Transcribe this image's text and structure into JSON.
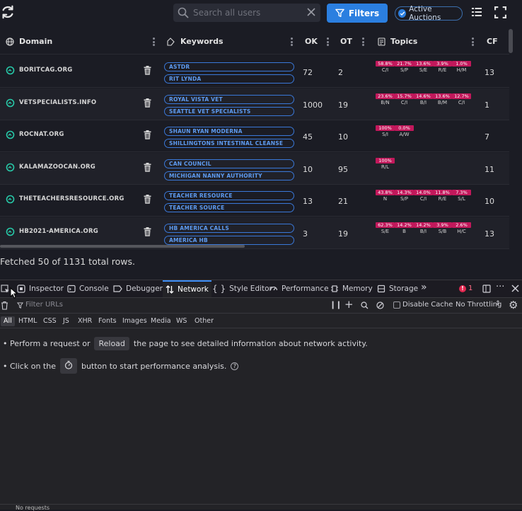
{
  "app": {
    "search": {
      "placeholder": "Search all users"
    },
    "filters_label": "Filters",
    "active_auctions_label": "Active Auctions",
    "columns": {
      "domain": "Domain",
      "keywords": "Keywords",
      "ok": "OK",
      "ot": "OT",
      "topics": "Topics",
      "cf": "CF"
    },
    "rows": [
      {
        "domain": "BORITCAG.ORG",
        "keywords": [
          "ASTDR",
          "RIT LYNDA"
        ],
        "ok": "72",
        "ot": "2",
        "cf": "13",
        "topics": [
          {
            "pct": "58.8%",
            "label": "C/I"
          },
          {
            "pct": "21.7%",
            "label": "S/P"
          },
          {
            "pct": "13.6%",
            "label": "S/E"
          },
          {
            "pct": "3.9%",
            "label": "R/E"
          },
          {
            "pct": "1.0%",
            "label": "H/M"
          }
        ]
      },
      {
        "domain": "VETSPECIALISTS.INFO",
        "keywords": [
          "ROYAL VISTA VET",
          "SEATTLE VET SPECIALISTS"
        ],
        "ok": "1000",
        "ot": "19",
        "cf": "1",
        "topics": [
          {
            "pct": "23.6%",
            "label": "B/N"
          },
          {
            "pct": "15.7%",
            "label": "C/I"
          },
          {
            "pct": "14.6%",
            "label": "B/I"
          },
          {
            "pct": "13.6%",
            "label": "B/M"
          },
          {
            "pct": "12.7%",
            "label": "C/I"
          }
        ]
      },
      {
        "domain": "ROCNAT.ORG",
        "keywords": [
          "SHAUN RYAN MODERNA",
          "SHILLINGTONS INTESTINAL CLEANSE"
        ],
        "ok": "45",
        "ot": "10",
        "cf": "7",
        "topics": [
          {
            "pct": "100%",
            "label": "S/I"
          },
          {
            "pct": "0.0%",
            "label": "A/W"
          }
        ]
      },
      {
        "domain": "KALAMAZOOCAN.ORG",
        "keywords": [
          "CAN COUNCIL",
          "MICHIGAN NANNY AUTHORITY"
        ],
        "ok": "10",
        "ot": "95",
        "cf": "11",
        "topics": [
          {
            "pct": "100%",
            "label": "R/L"
          }
        ]
      },
      {
        "domain": "THETEACHERSRESOURCE.ORG",
        "keywords": [
          "TEACHER RESOURCE",
          "TEACHER SOURCE"
        ],
        "ok": "13",
        "ot": "21",
        "cf": "10",
        "topics": [
          {
            "pct": "43.8%",
            "label": "N"
          },
          {
            "pct": "14.3%",
            "label": "S/P"
          },
          {
            "pct": "14.0%",
            "label": "C/I"
          },
          {
            "pct": "11.8%",
            "label": "R/E"
          },
          {
            "pct": "7.3%",
            "label": "S/L"
          }
        ]
      },
      {
        "domain": "HB2021-AMERICA.ORG",
        "keywords": [
          "HB AMERICA CALLS",
          "AMERICA HB"
        ],
        "ok": "3",
        "ot": "19",
        "cf": "13",
        "topics": [
          {
            "pct": "62.3%",
            "label": "S/E"
          },
          {
            "pct": "14.2%",
            "label": "B"
          },
          {
            "pct": "14.2%",
            "label": "B/I"
          },
          {
            "pct": "3.9%",
            "label": "S/B"
          },
          {
            "pct": "2.6%",
            "label": "H/C"
          }
        ]
      }
    ],
    "fetched_text": "Fetched 50 of 1131 total rows."
  },
  "devtools": {
    "tabs": [
      "Inspector",
      "Console",
      "Debugger",
      "Network",
      "Style Editor",
      "Performance",
      "Memory",
      "Storage"
    ],
    "active_tab": "Network",
    "error_count": "1",
    "filter_placeholder": "Filter URLs",
    "disable_cache_label": "Disable Cache",
    "throttling_label": "No Throttling",
    "type_filters": [
      "All",
      "HTML",
      "CSS",
      "JS",
      "XHR",
      "Fonts",
      "Images",
      "Media",
      "WS",
      "Other"
    ],
    "msg1": {
      "before": "Perform a request or",
      "button": "Reload",
      "after": "the page to see detailed information about network activity."
    },
    "msg2": {
      "before": "Click on the",
      "after": "button to start performance analysis."
    },
    "status": "No requests"
  },
  "colors": {
    "accent": "#2b7fe0",
    "topic_badge": "#c2185b",
    "keyword_border": "#3a78d8",
    "domain_icon": "#27c9a8"
  }
}
